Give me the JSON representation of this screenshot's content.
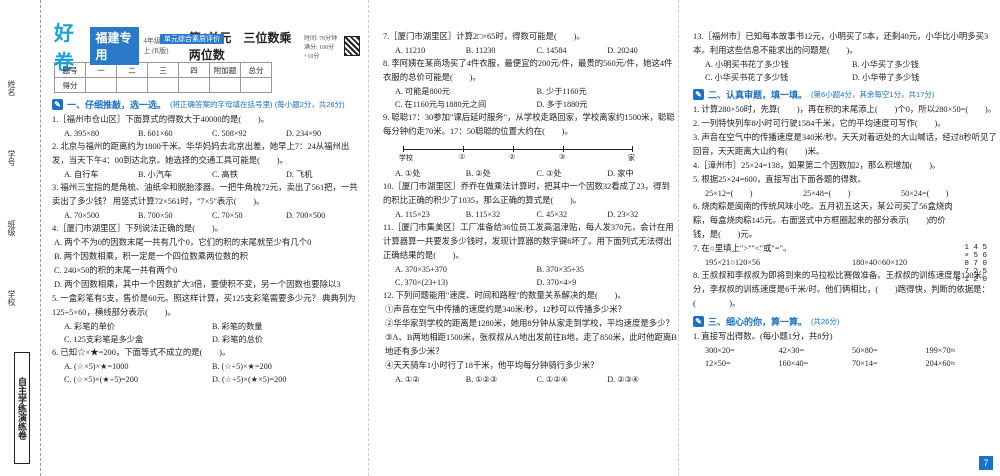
{
  "margin": {
    "labels": [
      "姓名",
      "学号",
      "班级",
      "学校"
    ],
    "brand": "自主学练演练卷"
  },
  "header": {
    "logo": "好卷",
    "badge": "福建专用",
    "grade": "4年级 数学 上 (R版)",
    "tag": "单元综合素质评价",
    "title": "第4单元　三位数乘两位数",
    "time": "时间: 70分钟  满分: 100分+10分"
  },
  "score_table": {
    "row1": [
      "题号",
      "一",
      "二",
      "三",
      "四",
      "附加题",
      "总分"
    ],
    "row2_label": "得分"
  },
  "col1": {
    "sec1": {
      "title": "一、仔细推敲，选一选。",
      "note": "(将正确答案的字母填在括号里) (每小题2分，共26分)"
    },
    "questions": [
      {
        "text": "1.［福州市仓山区］下面算式的得数大于40000的是(　　)。",
        "opts": [
          "A. 395×80",
          "B. 601×60",
          "C. 508×92",
          "D. 234×90"
        ]
      },
      {
        "text": "2. 北京与福州的距离约为1800千米。华华妈妈去北京出差，她早上7：24从福州出发，当天下午4：00到达北京。她选择的交通工具可能是(　　)。",
        "opts": [
          "A. 自行车",
          "B. 小汽车",
          "C. 高铁",
          "D. 飞机"
        ]
      },
      {
        "text": "3. 福州三宝指的是角梳、油纸伞和脱胎漆器。一把牛角梳72元，卖出了561把，一共卖出了多少钱？ 用竖式计算72×561时，\"7×5\"表示(　　)。",
        "opts": [
          "A. 70×500",
          "B. 700×50",
          "C. 70×50",
          "D. 700×500"
        ]
      },
      {
        "text": "4.［厦门市湖里区］下列说法正确的是(　　)。",
        "lines": [
          "A. 两个不为0的因数末尾一共有几个0，它们的积的末尾就至少有几个0",
          "B. 两个因数相乘，积一定是一个四位数乘两位数的积",
          "C. 240×50的积的末尾一共有两个0",
          "D. 两个因数相乘，其中一个因数扩大3倍，要使积不变，另一个因数也要除以3"
        ]
      },
      {
        "text": "5. 一盒彩笔有5支，售价是60元。照这样计算，买125支彩笔需要多少元？ 典典列为125÷5×60，横线部分表示(　　)。",
        "opts": [
          "A. 彩笔的单价",
          "B. 彩笔的数量"
        ],
        "opts2": [
          "C. 125支彩笔是多少盒",
          "D. 彩笔的总价"
        ]
      },
      {
        "text": "6. 已知☆×★=200，下面等式不成立的是(　　)。",
        "opts": [
          "A. (☆×5)×★=1000",
          "B. (☆÷5)×★=200"
        ],
        "opts2": [
          "C. (☆×5)×(★÷5)=200",
          "D. (☆÷5)×(★×5)=200"
        ]
      }
    ]
  },
  "col2": {
    "questions": [
      {
        "text": "7.［厦门市湖里区］计算2□×65时，得数可能是(　　)。",
        "opts": [
          "A. 11210",
          "B. 11230",
          "C. 14584",
          "D. 20240"
        ]
      },
      {
        "text": "8. 李阿姨在某商场买了4件衣服，最便宜的200元/件，最贵的560元/件，她这4件衣服的总价可能是(　　)。",
        "opts": [
          "A. 可能是800元",
          "B. 少于1160元"
        ],
        "opts2": [
          "C. 在1160元与1880元之间",
          "D. 多于1880元"
        ]
      },
      {
        "text": "9. 聪聪17：30参加\"课后延时服务\"，从学校走路回家，学校离家约1500米，聪聪每分钟约走70米。17：50聪聪的位置大约在(　　)。",
        "opts": [
          "A. ①处",
          "B. ②处",
          "C. ③处",
          "D. 家中"
        ]
      },
      {
        "text": "10.［厦门市湖里区］乔乔在做乘法计算时，把其中一个因数32看成了23，得到的积比正确的积少了1035，那么正确的算式是(　　)。",
        "opts": [
          "A. 115×23",
          "B. 115×32",
          "C. 45×32",
          "D. 23×32"
        ]
      },
      {
        "text": "11.［厦门市集美区］工厂准备给36位员工发高温津贴，每人发370元，会计在用计算器算一共要发多少钱时，发现计算器的数字键6坏了。用下面列式无法得出正确结果的是(　　)。",
        "opts": [
          "A. 370×35+370",
          "B. 370×35+35"
        ],
        "opts2": [
          "C. 370×(23+13)",
          "D. 370×4×9"
        ]
      },
      {
        "text": "12. 下列问题能用\"速度、时间和路程\"的数量关系解决的是(　　)。",
        "lines": [
          "①声音在空气中传播的速度约是340米/秒，12秒可以传播多少米？",
          "②华华家到学校的距离是1280米，她用8分钟从家走到学校，平均速度是多少？",
          "③A、B两地相距1500米，张叔叔从A地出发前往B地，走了850米，此时他距离B地还有多少米？",
          "④天天骑车1小时行了18千米，他平均每分钟骑行多少米？"
        ],
        "opts": [
          "A. ①②",
          "B. ①②③",
          "C. ①②④",
          "D. ②③④"
        ]
      }
    ],
    "numline": {
      "labels": [
        "学校",
        "①",
        "②",
        "③",
        "家"
      ]
    }
  },
  "col3": {
    "q13": {
      "text": "13.［福州市］已知每本故事书12元，小明买了5本，还剩40元，小华比小明多买3本。利用这些信息不能求出的问题是(　　)。",
      "opts": [
        "A. 小明买书花了多少钱",
        "B. 小华买了多少钱"
      ],
      "opts2": [
        "C. 小华买书花了多少钱",
        "D. 小华带了多少钱"
      ]
    },
    "sec2": {
      "title": "二、认真审题，填一填。",
      "note": "(第6小题4分，其余每空1分，共17分)"
    },
    "fill": [
      "1. 计算280×50时，先算(　　)，再在积的末尾添上(　　)个0，所以280×50=(　　)。",
      "2. 一列特快列车8小时可行驶1584千米，它的平均速度可写作(　　)。",
      "3. 声音在空气中的传播速度是340米/秒。天天对着远处的大山喊话，经过8秒听见了回音，天天距离大山约有(　　)米。",
      "4.［漳州市］25×24=138，如果第二个因数加2，那么积增加(　　)。",
      "5. 根据25×24=600，直接写出下面各题的得数。"
    ],
    "fill5": [
      "25×12=(　　)",
      "25×48=(　　)",
      "50×24=(　　)"
    ],
    "q6": "6. 烧肉粽是闽南的传统风味小吃。五月初五这天，某公司买了56盒烧肉粽，每盒烧肉粽145元。右面竖式中方框圈起来的部分表示(　　)的价钱，是(　　)元。",
    "vertical": [
      "1 4 5",
      "×   5 6",
      "8 7 0",
      "7 2 5",
      "8 1 2 0"
    ],
    "q7": "7. 在○里填上\">\"\"<\"或\"=\"。",
    "cmp": [
      "195×21○120×56",
      "180×40○60×120"
    ],
    "q8": "8. 王叔叔和李叔叔为即将到来的马拉松比赛做准备。王叔叔的训练速度是130米/分，李叔叔的训练速度是6千米/时。他们俩相比，(　　)跑得快，判断的依据是：(　　　　)。",
    "sec3": {
      "title": "三、细心的你，算一算。",
      "note": "(共26分)"
    },
    "calc_title": "1. 直接写出得数。(每小题1分，共8分)",
    "calc1": [
      "300×20=",
      "42×30=",
      "50×80=",
      "199×70≈"
    ],
    "calc2": [
      "12×50=",
      "160×40=",
      "70×14=",
      "204×60≈"
    ],
    "page": "7"
  }
}
